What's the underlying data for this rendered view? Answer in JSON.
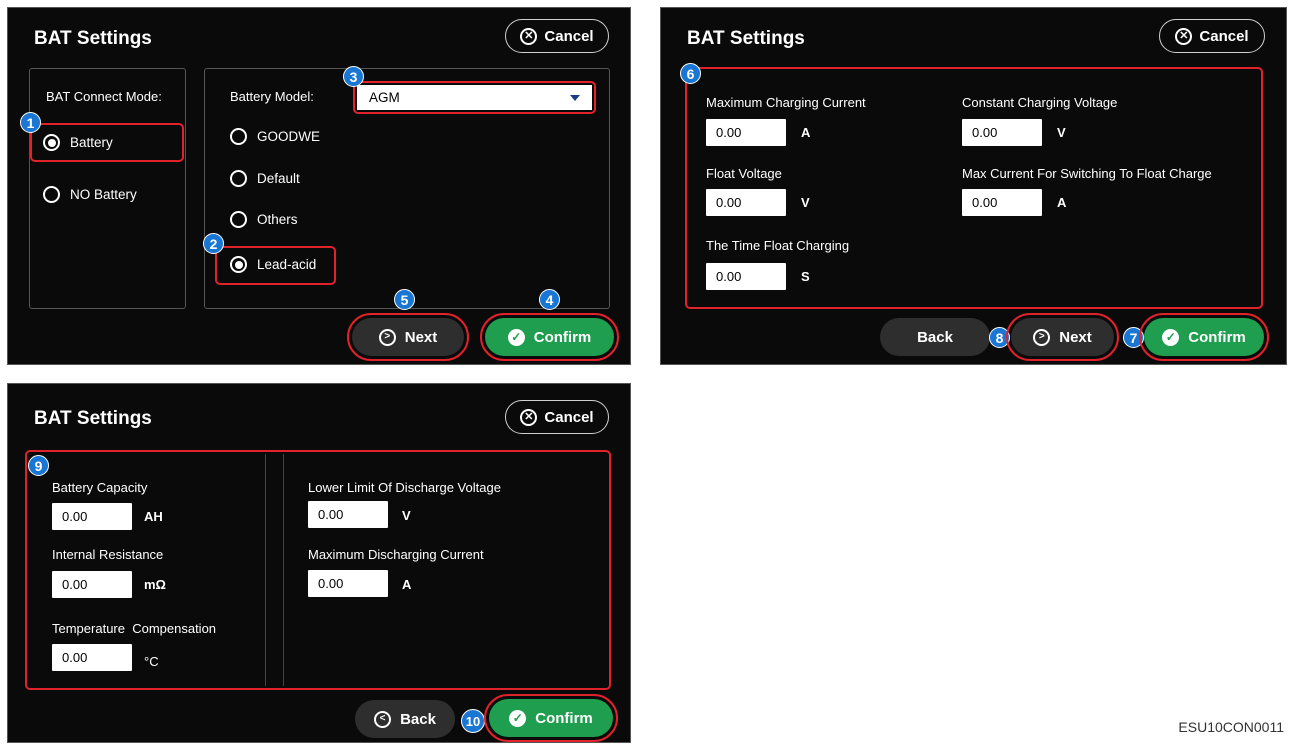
{
  "panel1": {
    "title": "BAT Settings",
    "cancel_label": "Cancel",
    "connect_mode_label": "BAT Connect Mode:",
    "connect_modes": [
      "Battery",
      "NO Battery"
    ],
    "battery_model_label": "Battery Model:",
    "battery_model_value": "AGM",
    "battery_types": [
      "GOODWE",
      "Default",
      "Others",
      "Lead-acid"
    ],
    "next_label": "Next",
    "confirm_label": "Confirm",
    "markers": [
      "1",
      "2",
      "3",
      "4",
      "5"
    ]
  },
  "panel2": {
    "title": "BAT Settings",
    "cancel_label": "Cancel",
    "fields": [
      {
        "label": "Maximum Charging Current",
        "value": "0.00",
        "unit": "A"
      },
      {
        "label": "Constant Charging Voltage",
        "value": "0.00",
        "unit": "V"
      },
      {
        "label": "Float Voltage",
        "value": "0.00",
        "unit": "V"
      },
      {
        "label": "Max Current For Switching To Float Charge",
        "value": "0.00",
        "unit": "A"
      },
      {
        "label": "The Time Float Charging",
        "value": "0.00",
        "unit": "S"
      }
    ],
    "back_label": "Back",
    "next_label": "Next",
    "confirm_label": "Confirm",
    "markers": [
      "6",
      "7",
      "8"
    ]
  },
  "panel3": {
    "title": "BAT Settings",
    "cancel_label": "Cancel",
    "fields": [
      {
        "label": "Battery Capacity",
        "value": "0.00",
        "unit": "AH"
      },
      {
        "label": "Internal Resistance",
        "value": "0.00",
        "unit": "mΩ"
      },
      {
        "label": "Temperature  Compensation",
        "value": "0.00",
        "unit": "°C"
      },
      {
        "label": "Lower Limit Of Discharge Voltage",
        "value": "0.00",
        "unit": "V"
      },
      {
        "label": "Maximum Discharging Current",
        "value": "0.00",
        "unit": "A"
      }
    ],
    "back_label": "Back",
    "confirm_label": "Confirm",
    "markers": [
      "9",
      "10"
    ]
  },
  "figure_code": "ESU10CON0011",
  "colors": {
    "highlight": "#e0222b",
    "marker": "#1976d2",
    "confirm": "#1e9e4e"
  }
}
